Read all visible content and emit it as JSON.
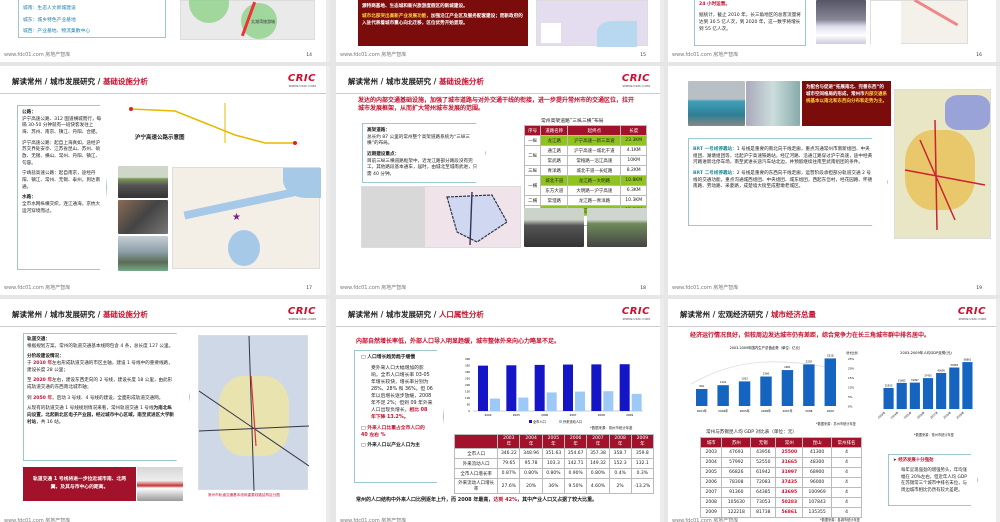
{
  "common": {
    "footer": "www.fdc01.com 房地产智库",
    "logo": "CRIC",
    "logo_sub": "WWW.CRIC.COM",
    "crumb_a": "解读常州 / 城市发展研究 / ",
    "crumb_b": "解读常州 / 宏观经济研究 / "
  },
  "s14": {
    "items": [
      "城南：生态人文新城建设",
      "城东：城乡特色产业基地",
      "城西：产业基地、物流集散中心"
    ],
    "map_label": "太湖湾旅游城",
    "page": "14"
  },
  "s15": {
    "text1": "源特商基地、生态城和新兴旅游度假区的新城建设。",
    "text2y": "城市北部突出高新产业发展功能，",
    "text2": "加强沿江产业区及服务配套建设；而新政府的入驻代表着城市重心向北迁移，区位优势开始显现。",
    "page": "15"
  },
  "s16": {
    "text1": "24 小时运营。",
    "text2": "据统计，截止 2010 年，长三角地区的总客流量将达到 30.5 亿人次，到 2020 年，这一数字将增长到 55 亿人次。",
    "page": "16"
  },
  "s17": {
    "section": "基础设施分析",
    "road_title": "公路：",
    "road1": "沪宁高速公路、312 国道横城而行，每隔 30-50 分钟就有一班快客发往上海、苏州、南京、镇江、丹阳、合肥。",
    "road2": "沪宁高速公路：起自上海真如，途经沪苏交界处安亭、江苏省昆山、苏州、硕放、无锡、横山、常州、丹阳、镇江、句容。",
    "road3": "宁靖盐高速公路：起自南京，途经丹阳、镇江、常州、无锡、泰州，到达南通。",
    "water_title": "水路：",
    "water": "全市水网纵横交织，连江通海，京杭大运河穿境而过。",
    "diagram_caption": "沪宁高速公路示意图",
    "page": "17"
  },
  "s18": {
    "section": "基础设施分析",
    "headline": "发达的内部交通基础设施，加强了城市道路与对外交通干线的衔接，进一步提升常州市的交通区位，拉开城市发展框架，从而扩大常州城市发展的范围。",
    "box_t1": "高架道路：",
    "box_1": "总长约 87 公里的常州整个高架道路系统为“三纵三横”的布局。",
    "box_t2": "近期建设重点：",
    "box_2": "目前三纵三横道路框架中，近龙江路部分路段没有完工，其他路段基本通车，届时，由城北至城南武进，只需 40 分钟。",
    "table_title": "常州高架道路“三纵三横”布局",
    "table_headers": [
      "序号",
      "道路名称",
      "起终点",
      "长度"
    ],
    "table_rows": [
      {
        "group": "一纵",
        "name": "龙江路",
        "route": "沪宁高速—新三高速",
        "len": "23.3KM",
        "hl": true
      },
      {
        "group": "二纵",
        "name": "通江路",
        "route": "沪宁高速—城北干道",
        "len": "4.1KM",
        "hl": false
      },
      {
        "group": "",
        "name": "常武路",
        "route": "常榕路—沿江高速",
        "len": "10KM",
        "hl": false
      },
      {
        "group": "三纵",
        "name": "青洋路",
        "route": "城北干道—长虹路",
        "len": "8.2KM",
        "hl": false
      },
      {
        "group": "一横",
        "name": "城北干道",
        "route": "龙江路—大明路",
        "len": "10.8KM",
        "hl": true
      },
      {
        "group": "",
        "name": "东方大道",
        "route": "大明路—沪宁高速",
        "len": "6.3KM",
        "hl": false
      },
      {
        "group": "二横",
        "name": "常澄路",
        "route": "龙江路—青洋路",
        "len": "10.3KM",
        "hl": false
      },
      {
        "group": "三横",
        "name": "长虹路",
        "route": "龙江路—青洋路",
        "len": "12.0KM",
        "hl": true
      }
    ],
    "table_total_label": "总计",
    "table_total": "87KM",
    "page": "18"
  },
  "s19": {
    "redbox_a": "为配合与促进“拓展南北、完善东西”的城市空间格局的形成，常州市",
    "redbox_y": "内部交通系统基本以南北和东西向分布和走势为主。",
    "brt1_t": "BRT 一号线停靠站：",
    "brt1": "1 号线是重要的南北向干线走廊，重点沟通常州市南新组团、中央组团、湖塘组团等，北起沪宁高速铁路站，经辽河路、沿通江路穿过沪宁高速，途中经黄河路进新北停车场，南至武进长途汽车站北边，并预留继续往南至武南组团的条件。",
    "brt2_t": "BRT 二号线停靠站：",
    "brt2": "2 号线是重要的东西向干线走廊，运营阶段承担部分轨道交通 2 号线的交通功能，重点沟通城西组团、中央组团、城东组团，西起东岱村，经花园路、怀德南路、劳动路、采菱路，成楚墙大街至成墅墩老城区。",
    "page": "19"
  },
  "s20": {
    "section": "基础设施分析",
    "t1": "轨道交通：",
    "p1": "根据规划方案，常州的轨道交通基本线网包含 4 条，总长度 127 公里。",
    "t2": "分阶段建设情况：",
    "p2a": "于 ",
    "p2y": "2010 年",
    "p2b": "左右形成轨道交通的市区主轴，建设 1 号线中的重要线路，建设长度 28 公里；",
    "p3a": "至 ",
    "p3y": "2020 年",
    "p3b": "左右，建设东西走向的 2 号线，建设长度 18 公里，由此形成轨道交通的东西南北城市轴；",
    "p4a": "到 ",
    "p4y": "2050 年",
    "p4b": "，启动 3 号线、4 号线的建设，全面形成轨道交通网。",
    "p5a": "从现有的轨道交通 1 号线规划情况来看，常州轨道交通 1 号线",
    "p5b": "为南北纵向设置，北起新北区电子产业园，经过城市中心区域，南至武进区大学新村站",
    "p5c": "，共 16 站。",
    "redbox": "轨道交通 1 号线将进一步拉近城市南、北两翼，及其与市中心的距离。",
    "map_caption": "常州市轨道交通基本线网重要线路结构区分图"
  },
  "s21": {
    "section": "人口属性分析",
    "headline": "内部自然增长率低，外部人口导入明显趋缓，城市整体外来向心力略显不足。",
    "b1": "人口增长趋势趋于缓慢",
    "b1_text": "受外来人口大幅增加的影响，全市人口增长率 03-05 年增长较快，增长率分别为 28%、28% 和 36%，但 06 年以后增长逐步放缓，2008 年不足 2%；但到 09 年外来人口出现负增长，",
    "b1_red": "相比 08 年下降 13.2%。",
    "b2": "外来人口比重占全市人口的 40 左右 %",
    "b3": "外来人口以产业人口为主",
    "source": "*数据来源：常州市统计年鉴",
    "footer_text_a": "常州的人口结构中外来人口比例逐年上升，而 2008 年最高，",
    "footer_text_red": "达到 42%",
    "footer_text_b": "，其中产业人口又占据了较大比重。",
    "table_headers": [
      "",
      "2003 年",
      "2004 年",
      "2005 年",
      "2006 年",
      "2007 年",
      "2008 年",
      "2009 年"
    ],
    "table_rows": [
      [
        "全市人口",
        "346.22",
        "348.96",
        "351.63",
        "354.67",
        "357.38",
        "358.7",
        "359.8"
      ],
      [
        "外来流动人口",
        "79.65",
        "95.78",
        "103.3",
        "142.71",
        "149.32",
        "152.3",
        "132.1"
      ],
      [
        "全市人口增长率",
        "0.87%",
        "0.80%",
        "0.80%",
        "0.90%",
        "0.80%",
        "0.4%",
        "0.3%"
      ],
      [
        "外来流动人口增长率",
        "27.6%",
        "20%",
        "36%",
        "9.50%",
        "4.60%",
        "2%",
        "-13.2%"
      ]
    ]
  },
  "s22": {
    "section": "城市经济总量",
    "headline": "经济运行情况良好，但较周边发达城市仍有差距，综合竞争力在长三角城市群中排名居中。",
    "table_title": "常州与苏锡昆人均 GDP 对比表（单位：元）",
    "table_headers": [
      "城市",
      "苏州",
      "无锡",
      "常州",
      "昆山",
      "常州排名"
    ],
    "table_rows": [
      [
        "2003",
        "47693",
        "43956",
        "25500",
        "41300",
        "4"
      ],
      [
        "2004",
        "57992",
        "52550",
        "31665",
        "48300",
        "4"
      ],
      [
        "2005",
        "66826",
        "61942",
        "31997",
        "68900",
        "4"
      ],
      [
        "2006",
        "78308",
        "72083",
        "37435",
        "96000",
        "4"
      ],
      [
        "2007",
        "91360",
        "64385",
        "43695",
        "100969",
        "4"
      ],
      [
        "2008",
        "105630",
        "73053",
        "50283",
        "107843",
        "4"
      ],
      [
        "2009",
        "122218",
        "81738",
        "56861",
        "135355",
        "4"
      ]
    ],
    "source1": "*数据来源：苏州市统计年鉴",
    "source2": "*数据来源：常州市统计年鉴",
    "source3": "*数据来源：各城市统计年鉴",
    "green_title": "经济发展十分强劲",
    "green_text": "每年呈现强劲的增强势头，年均涨幅在 20%左右，但近年人均 GDP 在苏锡常三个城市中排名末位，与周边城市相比仍然有较大差距。"
  },
  "chart_data": [
    {
      "type": "bar",
      "title": "",
      "categories": [
        "2004",
        "2005",
        "2006",
        "2007",
        "2008",
        "2009"
      ],
      "series": [
        {
          "name": "全市人口",
          "values": [
            348.96,
            351.63,
            354.67,
            357.38,
            358.7,
            359.8
          ],
          "color": "#1515c8"
        },
        {
          "name": "外来流动人口",
          "values": [
            95.78,
            103.3,
            142.71,
            149.32,
            152.3,
            132.1
          ],
          "color": "#9cc9f5"
        }
      ],
      "ylim": [
        0,
        400
      ]
    },
    {
      "type": "bar",
      "title": "2003-2009年国内生产总值走势（单位：亿元）",
      "categories": [
        "2003年",
        "2004年",
        "2005年",
        "2006年",
        "2007年",
        "2008",
        "2009"
      ],
      "values": [
        901,
        1101,
        1302,
        1560,
        1901,
        2202,
        2518
      ],
      "y2_label": "增长比例",
      "y2_ticks": [
        "25%",
        "20%",
        "15%",
        "10%",
        "5%",
        "0%"
      ],
      "ylim": [
        0,
        3000
      ],
      "color": "#1565c0"
    },
    {
      "type": "bar",
      "title": "2003-2009年人均GDP走势(元)",
      "categories": [
        "2003年",
        "2004年",
        "2005年",
        "2006年",
        "2007年",
        "2008年",
        "2009年"
      ],
      "values": [
        25500,
        31665,
        31997,
        37435,
        43695,
        50283,
        56861
      ],
      "ylim": [
        0,
        60000
      ],
      "color": "#1565c0"
    }
  ]
}
